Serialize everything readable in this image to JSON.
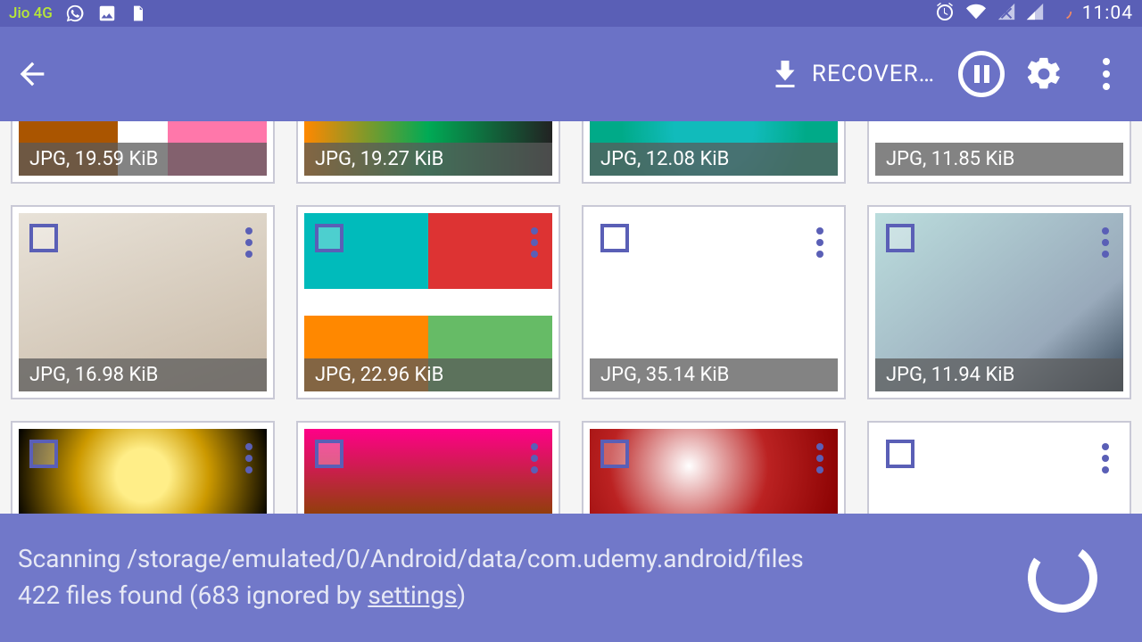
{
  "status": {
    "carrier": "Jio 4G",
    "time": "11:04"
  },
  "appbar": {
    "recover_label": "RECOVER…"
  },
  "tiles": [
    {
      "info": "JPG, 19.59 KiB",
      "thumb": "thumb1"
    },
    {
      "info": "JPG, 19.27 KiB",
      "thumb": "thumb2"
    },
    {
      "info": "JPG, 12.08 KiB",
      "thumb": "thumb3"
    },
    {
      "info": "JPG, 11.85 KiB",
      "thumb": "thumb4"
    },
    {
      "info": "JPG, 16.98 KiB",
      "thumb": "thumb5"
    },
    {
      "info": "JPG, 22.96 KiB",
      "thumb": "thumb6"
    },
    {
      "info": "JPG, 35.14 KiB",
      "thumb": "thumb7"
    },
    {
      "info": "JPG, 11.94 KiB",
      "thumb": "thumb8"
    },
    {
      "info": "",
      "thumb": "thumb9"
    },
    {
      "info": "",
      "thumb": "thumb10"
    },
    {
      "info": "",
      "thumb": "thumb11"
    },
    {
      "info": "",
      "thumb": "thumb12"
    }
  ],
  "scan": {
    "line1": "Scanning /storage/emulated/0/Android/data/com.udemy.android/files",
    "line2_pre": "422 files found (683 ignored by ",
    "settings_word": "settings",
    "line2_post": ")"
  }
}
